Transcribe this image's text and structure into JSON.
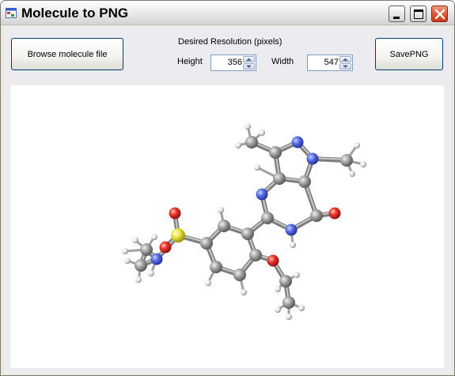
{
  "window": {
    "title": "Molecule to PNG",
    "icon": "app-window-icon",
    "controls": [
      "minimize-icon",
      "maximize-icon",
      "close-icon"
    ]
  },
  "toolbar": {
    "browse_label": "Browse molecule file",
    "save_label": "SavePNG",
    "resolution_label": "Desired Resolution (pixels)",
    "height_label": "Height",
    "height_value": "356",
    "width_label": "Width",
    "width_value": "547"
  },
  "render": {
    "description_icon": "molecule-ball-and-stick",
    "colors": {
      "carbon": "#8c8c8c",
      "nitrogen": "#4a5fd8",
      "oxygen": "#e0261e",
      "sulfur": "#e8e236",
      "hydrogen": "#ffffff"
    }
  }
}
